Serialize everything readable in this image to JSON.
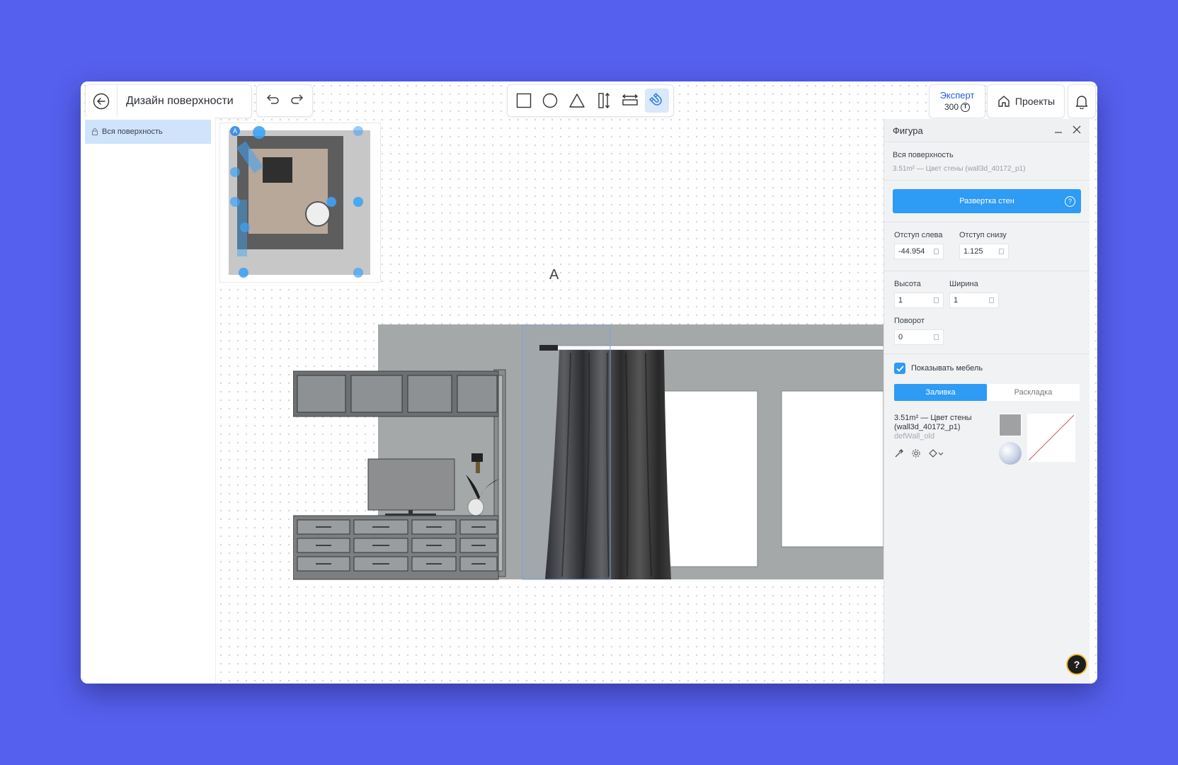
{
  "header": {
    "title": "Дизайн поверхности",
    "expert_label": "Эксперт",
    "expert_balance": "300",
    "coin_symbol": "Т",
    "projects_label": "Проекты"
  },
  "tools": [
    "rectangle-icon",
    "circle-icon",
    "triangle-icon",
    "vertical-size-icon",
    "horizontal-size-icon",
    "magnet-icon"
  ],
  "left_panel": {
    "item": "Вся поверхность"
  },
  "minimap": {
    "corner_label": "A"
  },
  "canvas": {
    "section_label": "A"
  },
  "panel": {
    "title": "Фигура",
    "surface": "Вся поверхность",
    "surface_info": "3.51m² — Цвет стены (wall3d_40172_p1)",
    "unfold_button": "Развертка стен",
    "offset_left_label": "Отступ слева",
    "offset_left": "-44.954",
    "offset_bottom_label": "Отступ снизу",
    "offset_bottom": "1.125",
    "height_label": "Высота",
    "height": "1",
    "width_label": "Ширина",
    "width": "1",
    "rotation_label": "Поворот",
    "rotation": "0",
    "show_furniture": "Показывать мебель",
    "tab_fill": "Заливка",
    "tab_layout": "Раскладка",
    "material_title": "3.51m² — Цвет стены (wall3d_40172_p1)",
    "material_sub": "defWall_old"
  },
  "colors": {
    "accent": "#2e9bf5",
    "background": "#5660ee",
    "wall": "#a5a8a9"
  }
}
